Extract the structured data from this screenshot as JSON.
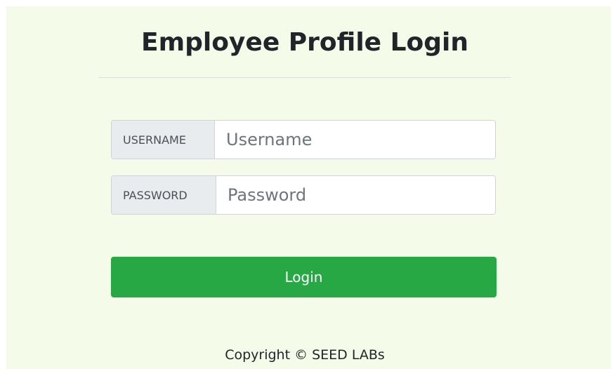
{
  "page": {
    "title": "Employee Profile Login"
  },
  "form": {
    "username_label": "USERNAME",
    "username_placeholder": "Username",
    "username_value": "",
    "password_label": "PASSWORD",
    "password_placeholder": "Password",
    "password_value": "",
    "login_label": "Login"
  },
  "footer": {
    "copyright": "Copyright © SEED LABs"
  },
  "colors": {
    "panel_background": "#f4fce9",
    "login_button": "#28a745",
    "label_background": "#e9ecef"
  }
}
